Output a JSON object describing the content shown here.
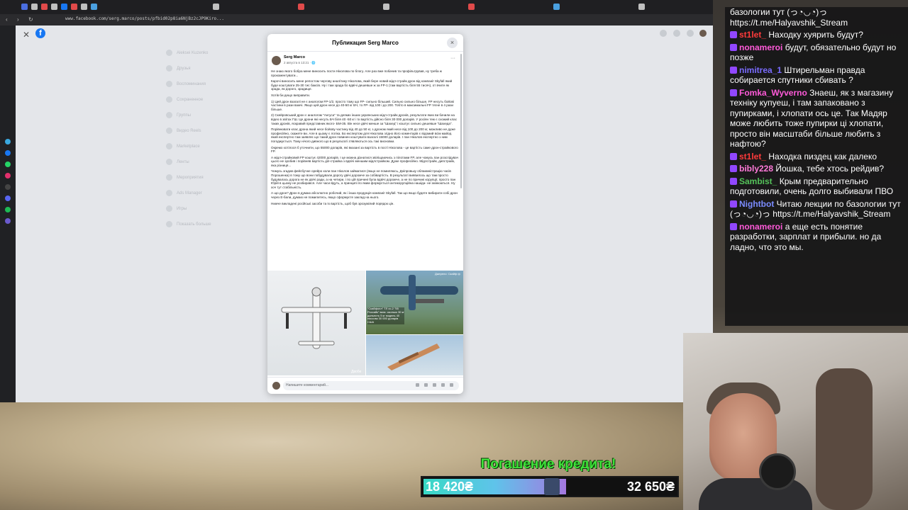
{
  "browser": {
    "url": "www.facebook.com/serg.marco/posts/pfbid02p8ia6NjBz2cJP9Kiro..."
  },
  "facebook": {
    "logo": "f",
    "sidebar": [
      "Aleksei Kuzenko",
      "Друзья",
      "Воспоминания",
      "Сохраненное",
      "Группы",
      "Видео Reels",
      "Marketplace",
      "Ленты",
      "Мероприятия",
      "Ads Manager",
      "Игры",
      "Показать больше"
    ],
    "modal_title": "Публикация Serg Marco",
    "close_icon": "×",
    "post": {
      "author": "Serg Marco",
      "date": "2 августа в 13:21 · 🌐",
      "more": "···",
      "paragraphs": [
        "Не знаю якого бобра мене виносить пости Ніколова по блогу. Але раз вже побачив та профільтрував, ну треба ж прокоментувати...",
        "Карочі виносить мене репостом чергову аналітику Ніколова, який бере новий мідл-страйк дрон від компанії Skyfall який буде коштувати 25-30 тис баксів. Ну і там зрада бо вдвічі дешевше ж за FP-1 (там вартість біля 55 тисяч), от вчите як зрада, як дорого, зрадище.",
        "Хотів би дещо виправити.",
        "1) Цей дрон взагалі не є аналогом FP-1/2, просто тому що FP- сильно більший. Сильно сильно більше, FP несуть бойові частини в рази важчі. Якщо цей дрон несе до 40-50 кг БЧ, то FP- від 100 і до 200. Тобто в максимальні FP тягне в 4 рази більше.",
        "2) Скейровський дрон є аналогом \"Ангуса\" та деяких інших українських мідл-страйк дронів, результати яких ви бачили на відео в звітах ГШ. Це дрони які несуть БЧ біля 40 -50 кг і їх вартість дійсно біля 30 000 доларів. У росіян теж є схожий клас таких дронів, яскравий представник якого- БМ-35. Він несе двічі менше за \"Шахед\" і коштує сильно дешевше \"Шахеда\".",
        "Порівнювати клас дрона який несе бойову частину від 40 до 50 кг, з дроном який несе від 100 до 200 кг, можливо не дуже професійно, скажете ви. Але в цьому є логіка. Бо експертом для Ніколова згідно його коментарів є відомий всім майор, який експертно там заявляє що такий дрон повинен коштувати взагалі 15000 доларів. І пан Ніколов експертно з ним погоджується. Тому нічого дивного що в результаті з'являються ось такі висновки.",
        "Окремо хотілося б уточнити, що 55000 доларів, які вказані за вартість в пості Ніколова - це вартість саме дрон-страйкового FP.",
        "А мідл-страйковий FP коштує 42000 доларів. І це можна дізнатися звіліщаючись з пілотами FP, але чомусь пан розслідувач цього не зробив і порівняв вартість діп-страйка з вдвічі меншим мідлстрайком. Дуже професійно. Мідлстрайк, дипстрайк, яка різниця...",
        "Чомусь згадав фейсбучне орейро коли пан Ніколов займатися (якщо не помиляюсь, Дніпровьку облакмністрацію часів Порошенка) в тому що вони побудували дорогу двічі дорожче за собівартість. В результаті виявилось що там просто будувалась дорога не як двічі ради, а на четири, і по цій причині була вдвічі дорожче, а не по причині корупції, просто пан Юрій в цьому не розбирався. Але часи йдуть, а принципі по яким формується антикорупційна нашіда- не змінюються. Ну хоч тут стабільність.",
        "А що дрон? Дрон в думаю абсолютно робочий, як і інша продукція компанії Skyfall. Так що якщо будете вибирати собі дрон через Е-бали, думаю не помилитесь, якщо сформуєте заклад на нього.",
        "Нижче викладені російські засоби та їх вартість, щоб був зрозумілий порядок цін."
      ],
      "image2_caption": "\"Скайфолл\" ТЛ сс-2 \"55 Российк\" вага: сколько 30 кг дальнсть 5 кг модель 40 пассовк 30 000 доларів США",
      "image2_credit": "Джерело: Скайф ф",
      "image1_credit": "Двобе",
      "comment_placeholder": "Напишите комментарий..."
    }
  },
  "chat": [
    {
      "user": "",
      "color": "#ffffff",
      "text": "базологии тут (っ◔◡◔)っ https://t.me/Halyavshik_Stream"
    },
    {
      "user": "st1let_",
      "color": "#ff3b3b",
      "text": "Находку хуярить будут?"
    },
    {
      "user": "nonameroi",
      "color": "#ff5ad9",
      "text": "будут, обязательно будут но позже"
    },
    {
      "user": "nimitrea_1",
      "color": "#7a6cff",
      "text": "Штирельман правда собирается спутники сбивать ?"
    },
    {
      "user": "Fomka_Wyverno",
      "color": "#ff5ad9",
      "text": "Знаеш, як з магазину технiку купуеш, i там запаковано з пупирками, i хлопати ось це. Так Мадяр може любить тоже пупирки цi хлопати, просто вiн масштаби бiльше любить з нафтою?"
    },
    {
      "user": "st1let_",
      "color": "#ff3b3b",
      "text": "Находка пиздец как далеко"
    },
    {
      "user": "bibly228",
      "color": "#ff7ad9",
      "text": "Йошка, тебе хтось рейдив?"
    },
    {
      "user": "Sambist_",
      "color": "#55c25a",
      "text": "Крым предварительно подготовили, очень долго выбивали ПВО"
    },
    {
      "user": "Nightbot",
      "color": "#7b8cff",
      "text": "Читаю лекции по базологии тут (っ◔◡◔)っ https://t.me/Halyavshik_Stream"
    },
    {
      "user": "nonameroi",
      "color": "#ff5ad9",
      "text": "а еще есть понятие разработки, зарплат и прибыли. но да ладно, что это мы."
    }
  ],
  "donation": {
    "title": "Погашение кредита!",
    "current": "18 420₴",
    "goal": "32 650₴",
    "progress": 0.564
  },
  "colors": {
    "accent": "#1877f2",
    "donate_green": "#3fe23a"
  }
}
